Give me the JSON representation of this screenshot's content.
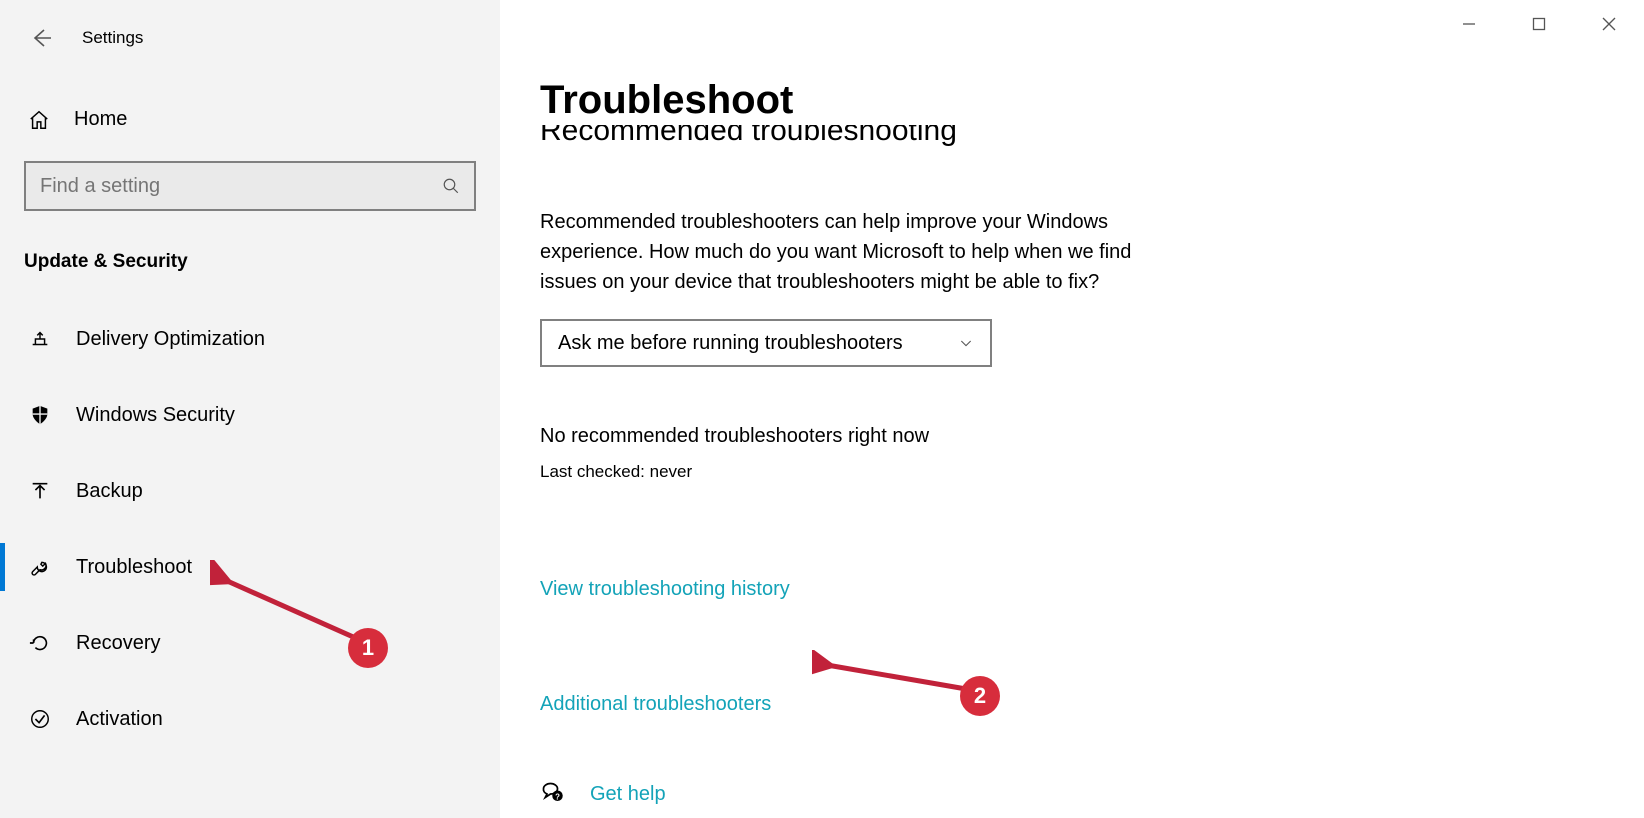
{
  "window": {
    "title": "Settings"
  },
  "sidebar": {
    "home_label": "Home",
    "search_placeholder": "Find a setting",
    "category": "Update & Security",
    "items": [
      {
        "label": "Delivery Optimization",
        "icon": "delivery-icon"
      },
      {
        "label": "Windows Security",
        "icon": "shield-icon"
      },
      {
        "label": "Backup",
        "icon": "backup-icon"
      },
      {
        "label": "Troubleshoot",
        "icon": "wrench-icon",
        "active": true
      },
      {
        "label": "Recovery",
        "icon": "recovery-icon"
      },
      {
        "label": "Activation",
        "icon": "check-circle-icon"
      }
    ]
  },
  "content": {
    "title": "Troubleshoot",
    "subtitle": "Recommended troubleshooting",
    "body": "Recommended troubleshooters can help improve your Windows experience. How much do you want Microsoft to help when we find issues on your device that troubleshooters might be able to fix?",
    "dropdown_value": "Ask me before running troubleshooters",
    "status": "No recommended troubleshooters right now",
    "substatus": "Last checked: never",
    "link_history": "View troubleshooting history",
    "link_additional": "Additional troubleshooters",
    "get_help": "Get help"
  },
  "annotations": {
    "one": "1",
    "two": "2"
  }
}
